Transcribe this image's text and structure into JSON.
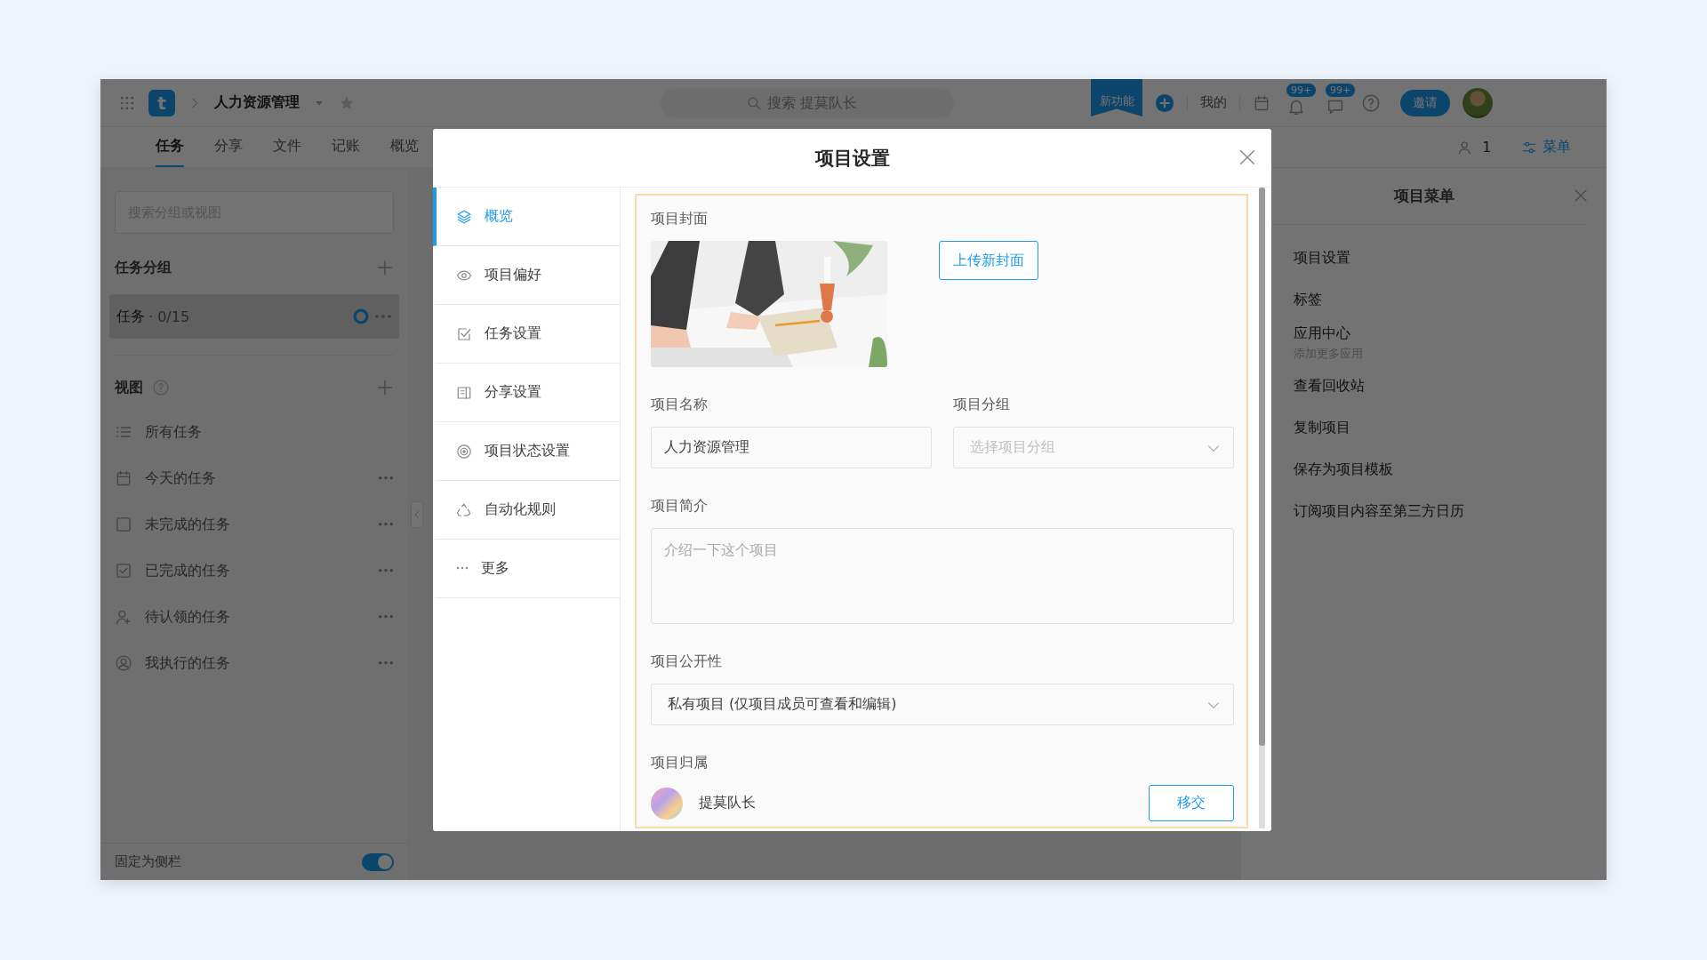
{
  "app_bar": {
    "logo_letter": "t",
    "project_name": "人力资源管理",
    "search": {
      "placeholder": "搜索 提莫队长"
    },
    "new_feature": "新功能",
    "mine": "我的",
    "badges": [
      "99+",
      "99+"
    ],
    "invite": "邀请"
  },
  "tabs": [
    {
      "label": "任务",
      "selected": true
    },
    {
      "label": "分享",
      "selected": false
    },
    {
      "label": "文件",
      "selected": false
    },
    {
      "label": "记账",
      "selected": false
    },
    {
      "label": "概览",
      "selected": false
    }
  ],
  "toolbar": {
    "member_count": "1",
    "menu": "菜单"
  },
  "sidebar": {
    "search": {
      "placeholder": "搜索分组或视图"
    },
    "groups_title": "任务分组",
    "groups": [
      {
        "label": "任务",
        "count": "· 0/15",
        "selected": true
      }
    ],
    "views_title": "视图",
    "views": [
      {
        "label": "所有任务",
        "more": false
      },
      {
        "label": "今天的任务",
        "more": true
      },
      {
        "label": "未完成的任务",
        "more": true
      },
      {
        "label": "已完成的任务",
        "more": true
      },
      {
        "label": "待认领的任务",
        "more": true
      },
      {
        "label": "我执行的任务",
        "more": true
      }
    ],
    "pin": {
      "label": "固定为侧栏",
      "on": true
    }
  },
  "project_menu": {
    "title": "项目菜单",
    "items": [
      {
        "label": "项目设置"
      },
      {
        "label": "标签"
      },
      {
        "label": "应用中心",
        "sub": "添加更多应用"
      },
      {
        "label": "查看回收站"
      },
      {
        "label": "复制项目"
      },
      {
        "label": "保存为项目模板"
      },
      {
        "label": "订阅项目内容至第三方日历"
      }
    ]
  },
  "dialog": {
    "title": "项目设置",
    "nav": [
      {
        "label": "概览",
        "selected": true
      },
      {
        "label": "项目偏好",
        "selected": false
      },
      {
        "label": "任务设置",
        "selected": false
      },
      {
        "label": "分享设置",
        "selected": false
      },
      {
        "label": "项目状态设置",
        "selected": false
      },
      {
        "label": "自动化规则",
        "selected": false
      },
      {
        "label": "更多",
        "selected": false
      }
    ],
    "cover": {
      "label": "项目封面",
      "kind": "picture",
      "upload": "上传新封面"
    },
    "name": {
      "label": "项目名称",
      "value": "人力资源管理"
    },
    "group": {
      "label": "项目分组",
      "placeholder": "选择项目分组"
    },
    "description": {
      "label": "项目简介",
      "placeholder": "介绍一下这个项目"
    },
    "visibility": {
      "label": "项目公开性",
      "value": "私有项目 (仅项目成员可查看和编辑)"
    },
    "owner": {
      "label": "项目归属",
      "name": "提莫队长",
      "transfer": "移交"
    }
  }
}
